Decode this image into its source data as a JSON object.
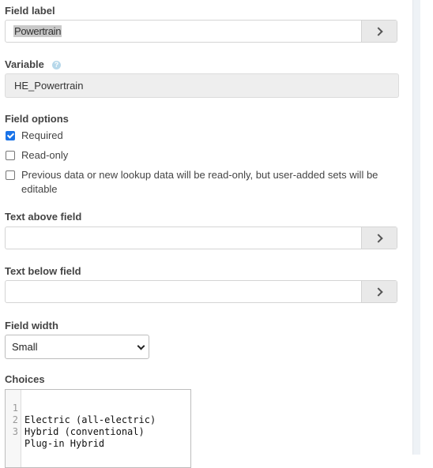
{
  "field_label": {
    "label": "Field label",
    "value": "Powertrain"
  },
  "variable": {
    "label": "Variable",
    "value": "HE_Powertrain",
    "help_icon": "help-icon"
  },
  "field_options": {
    "label": "Field options",
    "items": [
      {
        "label": "Required",
        "checked": true
      },
      {
        "label": "Read-only",
        "checked": false
      },
      {
        "label": "Previous data or new lookup data will be read-only, but user-added sets will be editable",
        "checked": false
      }
    ]
  },
  "text_above": {
    "label": "Text above field",
    "value": ""
  },
  "text_below": {
    "label": "Text below field",
    "value": ""
  },
  "field_width": {
    "label": "Field width",
    "selected": "Small"
  },
  "choices": {
    "label": "Choices",
    "lines": [
      {
        "n": "1",
        "text": "Electric (all-electric)"
      },
      {
        "n": "2",
        "text": "Hybrid (conventional)"
      },
      {
        "n": "3",
        "text": "Plug-in Hybrid"
      }
    ]
  },
  "colors": {
    "checkbox_accent": "#1a73e8",
    "readonly_bg": "#eeeeee",
    "button_bg": "#e9e9e9"
  }
}
